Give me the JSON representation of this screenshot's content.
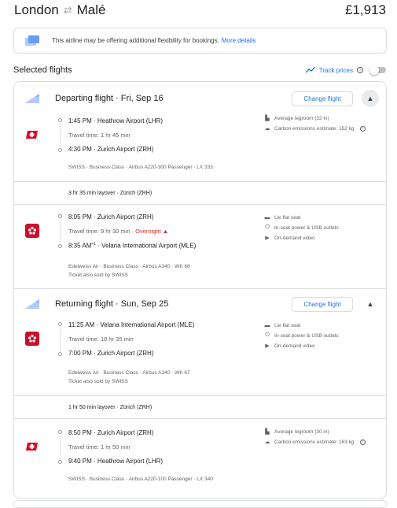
{
  "header": {
    "origin": "London",
    "destination": "Malé",
    "price": "£1,913"
  },
  "notice": {
    "text": "This airline may be offering additional flexibility for bookings.",
    "link": "More details"
  },
  "selected": {
    "title": "Selected flights",
    "track_label": "Track prices",
    "info": "i"
  },
  "departing": {
    "title": "Departing flight · Fri, Sep 16",
    "change_label": "Change flight",
    "legs": [
      {
        "dep": "1:45 PM · Heathrow Airport (LHR)",
        "travel": "Travel time: 1 hr 45 min",
        "arr": "4:30 PM · Zurich Airport (ZRH)",
        "meta": "SWISS · Business Class · Airbus A220-300 Passenger · LX 333",
        "meta2": "",
        "amenities": [
          "Average legroom (32 in)",
          "Carbon emissions estimate: 152 kg"
        ]
      },
      {
        "dep": "8:05 PM · Zurich Airport (ZRH)",
        "travel": "Travel time: 9 hr 30 min · ",
        "overnight": "Overnight",
        "arr": "8:35 AM",
        "arr_sup": "+1",
        "arr_rest": " · Velana International Airport (MLE)",
        "meta": "Edelweiss Air · Business Class · Airbus A340 · WK 66",
        "meta2": "Ticket also sold by SWISS",
        "amenities": [
          "Lie flat seat",
          "In-seat power & USB outlets",
          "On-demand video"
        ]
      }
    ],
    "layover": "3 hr 35 min layover · Zürich (ZRH)"
  },
  "returning": {
    "title": "Returning flight · Sun, Sep 25",
    "change_label": "Change flight",
    "legs": [
      {
        "dep": "11:25 AM · Velana International Airport (MLE)",
        "travel": "Travel time: 10 hr 35 min",
        "arr": "7:00 PM · Zurich Airport (ZRH)",
        "meta": "Edelweiss Air · Business Class · Airbus A340 · WK 67",
        "meta2": "Ticket also sold by SWISS",
        "amenities": [
          "Lie flat seat",
          "In-seat power & USB outlets",
          "On-demand video"
        ]
      },
      {
        "dep": "8:50 PM · Zurich Airport (ZRH)",
        "travel": "Travel time: 1 hr 50 min",
        "arr": "9:40 PM · Heathrow Airport (LHR)",
        "meta": "SWISS · Business Class · Airbus A220-100 Passenger · LX 340",
        "meta2": "",
        "amenities": [
          "Average legroom (30 in)",
          "Carbon emissions estimate: 163 kg"
        ]
      }
    ],
    "layover": "1 hr 50 min layover · Zürich (ZRH)"
  },
  "colors": {
    "accent": "#1a73e8",
    "swiss_red": "#e2001a",
    "edelweiss_red": "#c8102e",
    "overnight": "#d93025"
  }
}
